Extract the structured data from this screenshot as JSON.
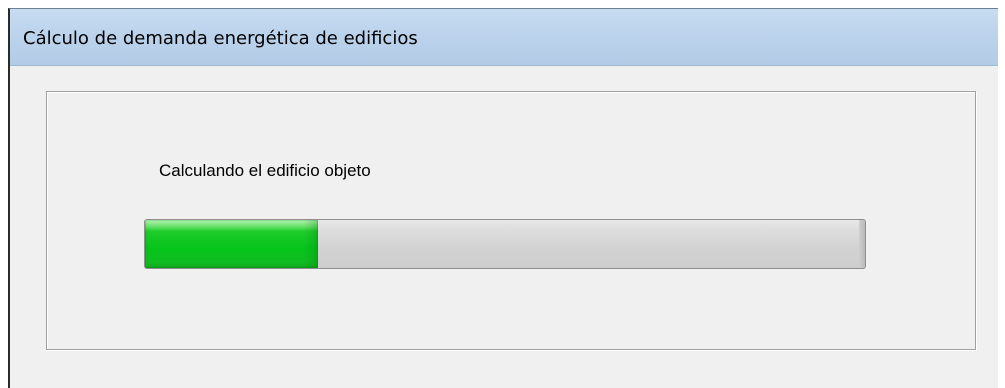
{
  "window": {
    "title": "Cálculo de demanda energética de edificios"
  },
  "progress": {
    "status_text": "Calculando el edificio objeto",
    "value_fraction": 0.24,
    "fill_color": "#06c41a",
    "track_color": "#d3d3d3"
  },
  "colors": {
    "titlebar": "#bcd3ec",
    "window_background": "#f0f0f0"
  }
}
